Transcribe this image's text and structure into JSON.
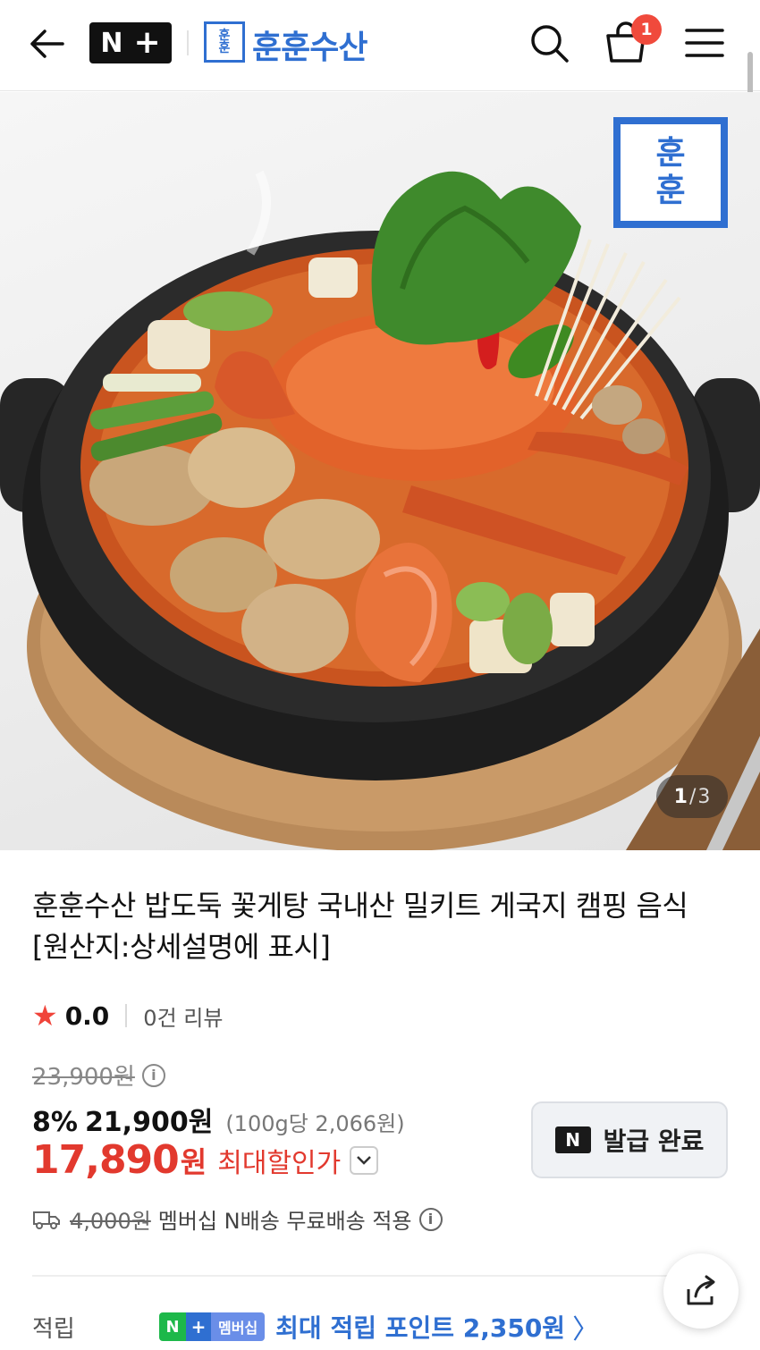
{
  "header": {
    "nplus_n": "N",
    "nplus_plus": "+",
    "store_logo_top": "훈",
    "store_logo_bottom": "훈",
    "store_name": "훈훈수산",
    "cart_count": "1"
  },
  "hero": {
    "brand_mark_top": "훈",
    "brand_mark_bottom": "훈",
    "counter_current": "1",
    "counter_sep": "/",
    "counter_total": "3"
  },
  "product": {
    "title": "훈훈수산 밥도둑 꽃게탕 국내산 밀키트 게국지 캠핑 음식 [원산지:상세설명에 표시]",
    "rating_score": "0.0",
    "review_count": "0건 리뷰",
    "original_price": "23,900원",
    "discount_pct": "8%",
    "sale_price": "21,900원",
    "unit_price": "(100g당 2,066원)",
    "best_price_amount": "17,890",
    "best_price_won": "원",
    "best_price_label": "최대할인가",
    "coupon_chip": "N",
    "coupon_label": "발급 완료",
    "shipping_fee": "4,000원",
    "shipping_text": "멤버십 N배송 무료배송 적용",
    "points_label": "적립",
    "membership_n": "N",
    "membership_plus": "+",
    "membership_text": "멤버십",
    "points_text": "최대 적립 포인트 2,350원",
    "points_arrow": "〉"
  }
}
